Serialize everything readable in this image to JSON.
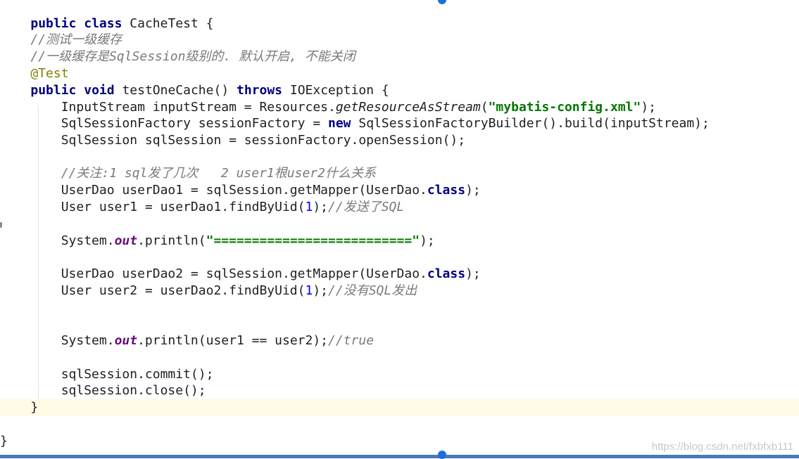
{
  "code": {
    "class_decl": {
      "kw1": "public",
      "kw2": "class",
      "name": "CacheTest {"
    },
    "comment1": "//测试一级缓存",
    "comment2": "//一级缓存是SqlSession级别的. 默认开启, 不能关闭",
    "annotation": "@Test",
    "method_decl": {
      "kw1": "public",
      "kw2": "void",
      "name": "testOneCache()",
      "kw3": "throws",
      "exc": "IOException {"
    },
    "l1": {
      "a": "InputStream inputStream = Resources.",
      "b": "getResourceAsStream",
      "c": "(",
      "d": "\"mybatis-config.xml\"",
      "e": ");"
    },
    "l2": {
      "a": "SqlSessionFactory sessionFactory = ",
      "kw": "new",
      "b": " SqlSessionFactoryBuilder().build(inputStream);"
    },
    "l3": "SqlSession sqlSession = sessionFactory.openSession();",
    "comment3": "//关注:1 sql发了几次   2 user1根user2什么关系",
    "l4": {
      "a": "UserDao userDao1 = sqlSession.getMapper(UserDao.",
      "kw": "class",
      "b": ");"
    },
    "l5": {
      "a": "User user1 = userDao1.findByUid(",
      "num": "1",
      "b": ");",
      "cm": "//发送了SQL"
    },
    "l6": {
      "a": "System.",
      "field": "out",
      "b": ".println(",
      "str": "\"==========================\"",
      "c": ");"
    },
    "l7": {
      "a": "UserDao userDao2 = sqlSession.getMapper(UserDao.",
      "kw": "class",
      "b": ");"
    },
    "l8": {
      "a": "User user2 = userDao2.findByUid(",
      "num": "1",
      "b": ");",
      "cm": "//没有SQL发出"
    },
    "l9": {
      "a": "System.",
      "field": "out",
      "b": ".println(user1 == user2);",
      "cm": "//true"
    },
    "l10": "sqlSession.commit();",
    "l11": "sqlSession.close();",
    "method_close": "}",
    "class_close": "}"
  },
  "watermark": "https://blog.csdn.net/fxbfxb111"
}
